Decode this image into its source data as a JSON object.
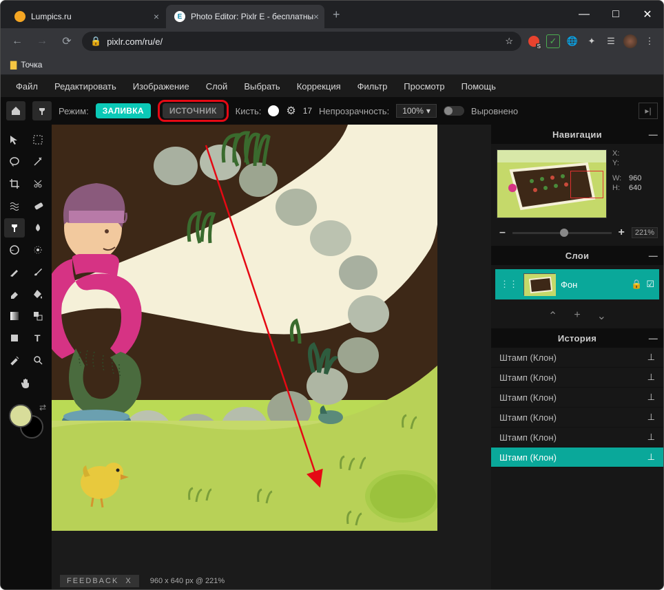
{
  "tabs": {
    "t1": "Lumpics.ru",
    "t2": "Photo Editor: Pixlr E - бесплатны"
  },
  "addr": {
    "url": "pixlr.com/ru/e/"
  },
  "bookmark": "Точка",
  "menu": [
    "Файл",
    "Редактировать",
    "Изображение",
    "Слой",
    "Выбрать",
    "Коррекция",
    "Фильтр",
    "Просмотр",
    "Помощь"
  ],
  "opt": {
    "mode_label": "Режим:",
    "mode_on": "ЗАЛИВКА",
    "mode_off": "ИСТОЧНИК",
    "brush_label": "Кисть:",
    "brush_size": "17",
    "opacity_label": "Непрозрачность:",
    "opacity_value": "100%",
    "aligned": "Выровнено"
  },
  "nav": {
    "title": "Навигации",
    "x": "X:",
    "y": "Y:",
    "wlabel": "W:",
    "w": "960",
    "hlabel": "H:",
    "h": "640",
    "zoom": "221%"
  },
  "layers": {
    "title": "Слои",
    "bg": "Фон"
  },
  "history": {
    "title": "История",
    "items": [
      "Штамп (Клон)",
      "Штамп (Клон)",
      "Штамп (Клон)",
      "Штамп (Клон)",
      "Штамп (Клон)",
      "Штамп (Клон)"
    ]
  },
  "status": {
    "feedback": "FEEDBACK",
    "fbx": "X",
    "dims": "960 x 640 px @ 221%"
  }
}
